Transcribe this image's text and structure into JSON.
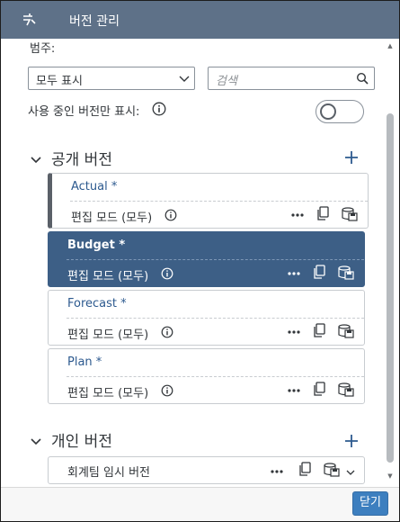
{
  "header": {
    "title": "버전 관리",
    "icon": "versions-icon"
  },
  "filter": {
    "category_label": "범주:",
    "category_value": "모두 표시",
    "search_placeholder": "검색",
    "show_in_use_label": "사용 중인 버전만 표시:",
    "show_in_use_on": false
  },
  "public_section": {
    "title": "공개 버전",
    "versions": [
      {
        "name": "Actual *",
        "mode": "편집 모드 (모두)"
      },
      {
        "name": "Budget *",
        "mode": "편집 모드 (모두)",
        "selected": true
      },
      {
        "name": "Forecast *",
        "mode": "편집 모드 (모두)"
      },
      {
        "name": "Plan *",
        "mode": "편집 모드 (모두)"
      }
    ]
  },
  "private_section": {
    "title": "개인 버전",
    "versions": [
      {
        "name": "회계팀 임시 버전"
      }
    ]
  },
  "footer": {
    "close_label": "닫기"
  },
  "colors": {
    "header": "#5e7188",
    "selected": "#3d5f86",
    "primary_button": "#3d7fbf"
  }
}
